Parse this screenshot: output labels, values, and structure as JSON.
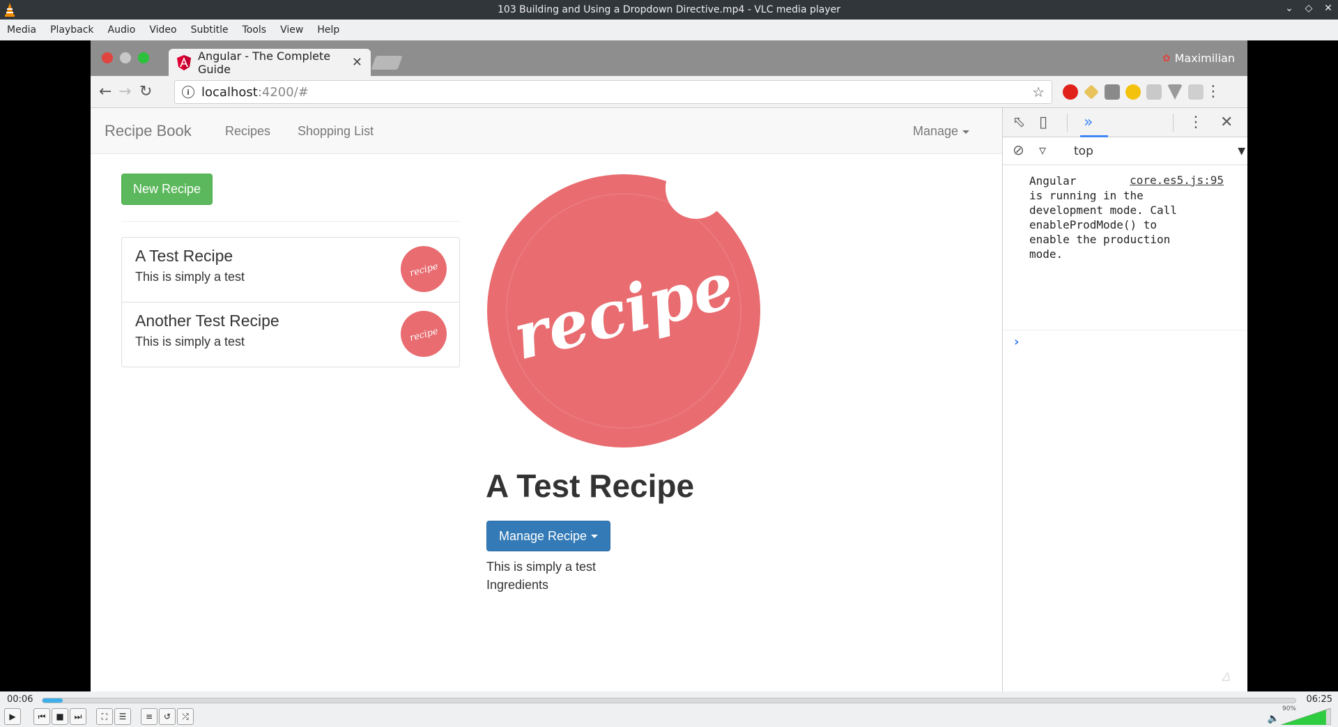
{
  "vlc": {
    "title": "103 Building and Using a Dropdown Directive.mp4 - VLC media player",
    "menu": [
      "Media",
      "Playback",
      "Audio",
      "Video",
      "Subtitle",
      "Tools",
      "View",
      "Help"
    ],
    "elapsed": "00:06",
    "total": "06:25",
    "progress": 0.016,
    "volume_label": "90%",
    "volume": 0.9
  },
  "browser": {
    "tab_title": "Angular - The Complete Guide",
    "profile_name": "Maximilian",
    "url_host": "localhost",
    "url_path": ":4200/#"
  },
  "app": {
    "brand": "Recipe Book",
    "nav": {
      "recipes": "Recipes",
      "shopping": "Shopping List",
      "manage": "Manage"
    },
    "new_recipe_label": "New Recipe",
    "recipes": [
      {
        "name": "A Test Recipe",
        "description": "This is simply a test"
      },
      {
        "name": "Another Test Recipe",
        "description": "This is simply a test"
      }
    ],
    "detail": {
      "title": "A Test Recipe",
      "manage_label": "Manage Recipe",
      "description": "This is simply a test",
      "ingredients_label": "Ingredients"
    },
    "image_text": "recipe"
  },
  "devtools": {
    "context": "top",
    "message": "Angular\nis running in the\ndevelopment mode. Call\nenableProdMode() to\nenable the production\nmode.",
    "source": "core.es5.js:95"
  },
  "colors": {
    "accent": "#3daee9",
    "success": "#5cb85c",
    "primary": "#337ab7",
    "recipe_red": "#e86c70"
  }
}
